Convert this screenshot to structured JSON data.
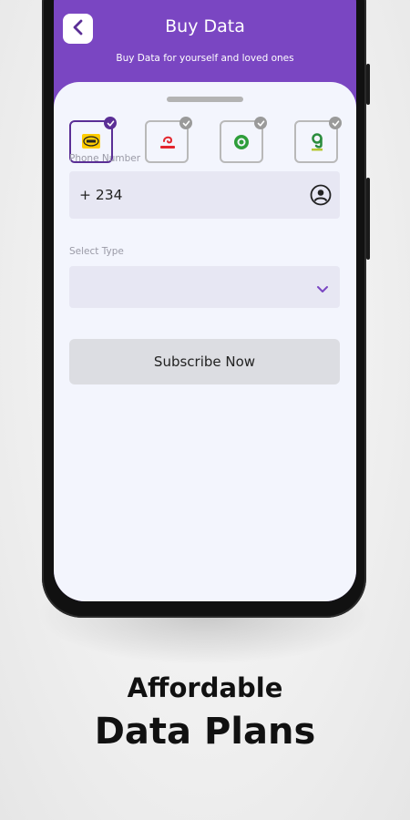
{
  "header": {
    "title": "Buy Data",
    "subtitle": "Buy Data for yourself and loved ones"
  },
  "networks": [
    {
      "name": "mtn-logo",
      "selected": true
    },
    {
      "name": "airtel-logo",
      "selected": false
    },
    {
      "name": "glo-logo",
      "selected": false
    },
    {
      "name": "9mobile-logo",
      "selected": false
    }
  ],
  "form": {
    "phone_label": "Phone Number",
    "phone_value": "+ 234",
    "type_label": "Select Type",
    "type_value": "",
    "submit_label": "Subscribe Now"
  },
  "caption": {
    "line1": "Affordable",
    "line2": "Data Plans"
  },
  "colors": {
    "accent": "#7a46c2",
    "selected_border": "#5b2f96"
  }
}
